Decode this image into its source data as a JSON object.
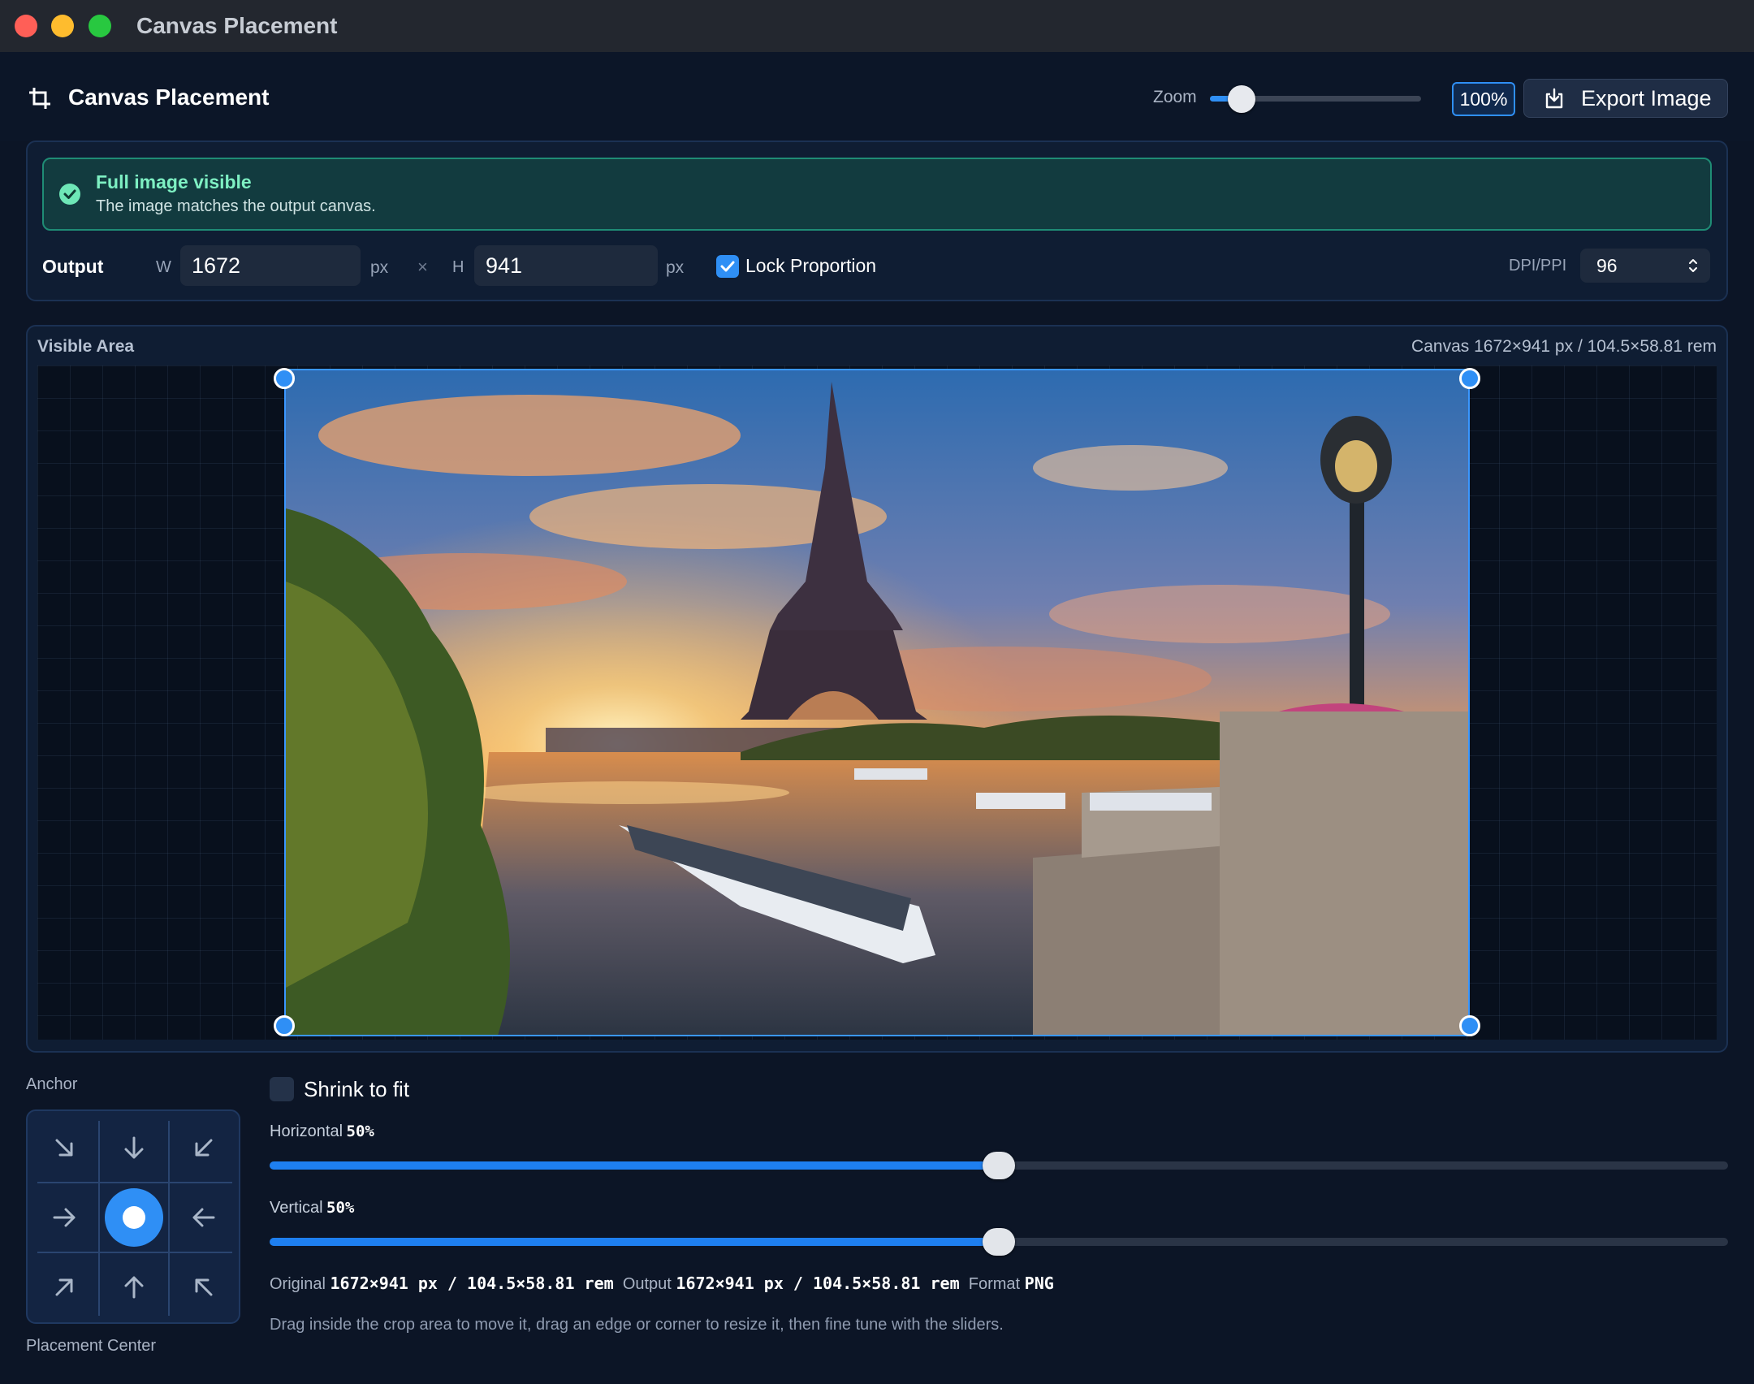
{
  "window": {
    "title": "Canvas Placement"
  },
  "header": {
    "title": "Canvas Placement",
    "zoom_label": "Zoom",
    "zoom_value": "100%",
    "zoom_level": 0.15,
    "export_label": "Export Image"
  },
  "status": {
    "title": "Full image visible",
    "message": "The image matches the output canvas."
  },
  "output": {
    "label": "Output",
    "w_label": "W",
    "width": "1672",
    "unit": "px",
    "times": "×",
    "h_label": "H",
    "height": "941",
    "lock_label": "Lock Proportion",
    "lock_checked": true,
    "dpi_label": "DPI/PPI",
    "dpi_value": "96"
  },
  "visible_area": {
    "label": "Visible Area",
    "canvas_info": "Canvas 1672×941 px / 104.5×58.81 rem"
  },
  "anchor": {
    "label": "Anchor",
    "caption": "Placement Center",
    "selected": "center",
    "cells": [
      "arrow-down-right-icon",
      "arrow-down-icon",
      "arrow-down-left-icon",
      "arrow-right-icon",
      "center-dot-icon",
      "arrow-left-icon",
      "arrow-up-right-icon",
      "arrow-up-icon",
      "arrow-up-left-icon"
    ]
  },
  "controls": {
    "shrink_label": "Shrink to fit",
    "shrink_checked": false,
    "horizontal_label": "Horizontal",
    "horizontal_value": "50%",
    "horizontal_level": 0.5,
    "vertical_label": "Vertical",
    "vertical_value": "50%",
    "vertical_level": 0.5
  },
  "info": {
    "original_label": "Original",
    "original_value": "1672×941 px / 104.5×58.81 rem",
    "output_label": "Output",
    "output_value": "1672×941 px / 104.5×58.81 rem",
    "format_label": "Format",
    "format_value": "PNG",
    "hint": "Drag inside the crop area to move it, drag an edge or corner to resize it, then fine tune with the sliders."
  },
  "colors": {
    "accent": "#2f8ff5",
    "success": "#7ef0c3",
    "background": "#0c1526"
  }
}
